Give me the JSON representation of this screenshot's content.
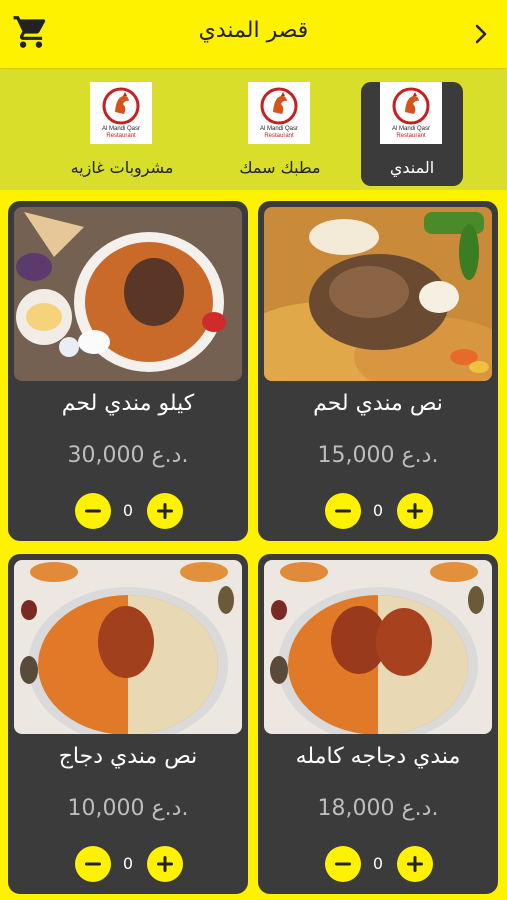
{
  "header": {
    "title": "قصر المندي",
    "cart_icon": "cart-icon",
    "back_icon": "chevron-right-icon"
  },
  "tabs": [
    {
      "label": "المندي",
      "active": true,
      "logo_text": "Al Mandi Qasr Restaurant"
    },
    {
      "label": "مطبك سمك",
      "active": false,
      "logo_text": "Al Mandi Qasr Restaurant"
    },
    {
      "label": "مشروبات غازيه",
      "active": false,
      "logo_text": "Al Mandi Qasr Restaurant"
    }
  ],
  "items": [
    {
      "name": "نص مندي لحم",
      "price": "15,000 د.ع.",
      "qty": "0"
    },
    {
      "name": "كيلو مندي لحم",
      "price": "30,000 د.ع.",
      "qty": "0"
    },
    {
      "name": "مندي دجاجه كامله",
      "price": "18,000 د.ع.",
      "qty": "0"
    },
    {
      "name": "نص مندي دجاج",
      "price": "10,000 د.ع.",
      "qty": "0"
    }
  ],
  "colors": {
    "accent": "#FFF200",
    "tab_bar": "#D9DE2B",
    "card": "#3B3B3B",
    "price": "#BDBDBD"
  }
}
